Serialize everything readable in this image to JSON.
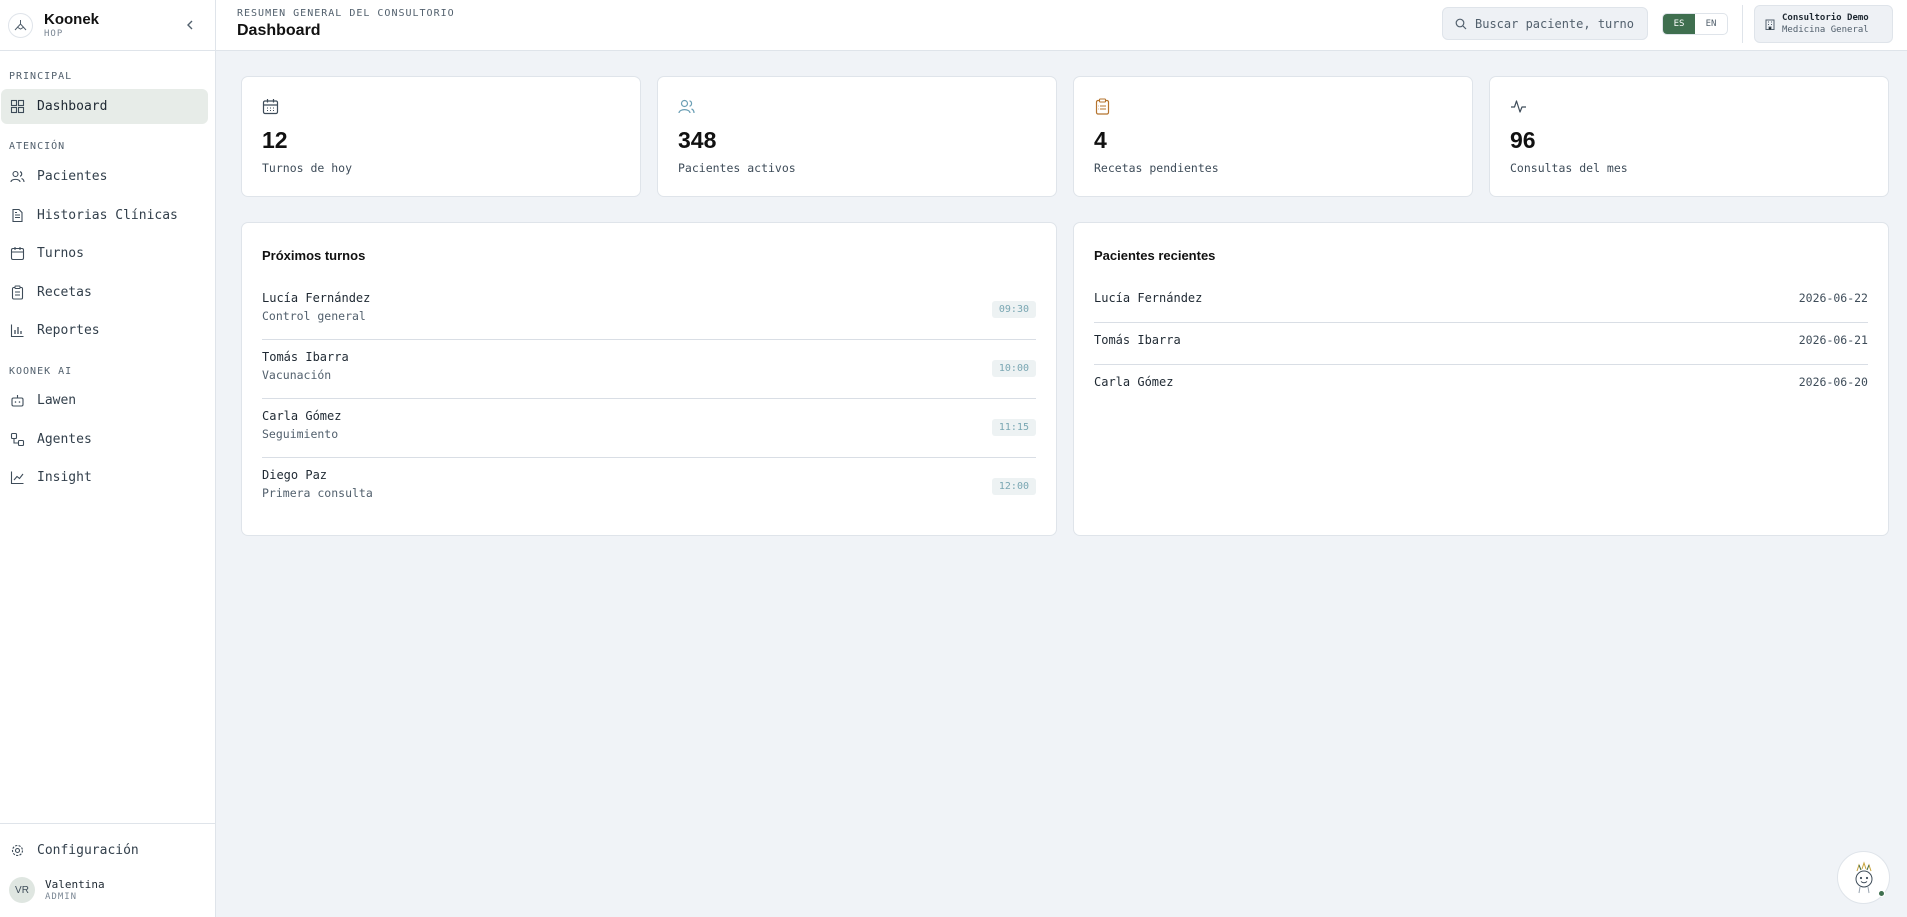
{
  "brand": {
    "name": "Koonek",
    "sub": "HOP"
  },
  "sidebar": {
    "sections": [
      {
        "label": "PRINCIPAL"
      },
      {
        "label": "ATENCIÓN"
      },
      {
        "label": "KOONEK AI"
      }
    ],
    "items": [
      {
        "label": "Dashboard",
        "icon": "grid-icon",
        "active": true
      },
      {
        "label": "Pacientes",
        "icon": "users-icon"
      },
      {
        "label": "Historias Clínicas",
        "icon": "file-text-icon"
      },
      {
        "label": "Turnos",
        "icon": "calendar-icon"
      },
      {
        "label": "Recetas",
        "icon": "clipboard-icon"
      },
      {
        "label": "Reportes",
        "icon": "bar-chart-icon"
      },
      {
        "label": "Lawen",
        "icon": "bot-icon"
      },
      {
        "label": "Agentes",
        "icon": "workflow-icon"
      },
      {
        "label": "Insight",
        "icon": "line-chart-icon"
      }
    ],
    "settings": {
      "label": "Configuración",
      "icon": "gear-icon"
    },
    "user": {
      "initials": "VR",
      "name": "Valentina",
      "role": "ADMIN"
    }
  },
  "header": {
    "kicker": "RESUMEN GENERAL DEL CONSULTORIO",
    "title": "Dashboard",
    "search_placeholder": "Buscar paciente, turno",
    "lang": {
      "es": "ES",
      "en": "EN",
      "selected": "ES"
    },
    "org": {
      "name": "Consultorio Demo",
      "sub": "Medicina General"
    }
  },
  "stats": [
    {
      "value": "12",
      "label": "Turnos de hoy",
      "icon": "calendar-icon",
      "color": "#3e4c59"
    },
    {
      "value": "348",
      "label": "Pacientes activos",
      "icon": "users-icon",
      "color": "#6b9fb5"
    },
    {
      "value": "4",
      "label": "Recetas pendientes",
      "icon": "clipboard-icon",
      "color": "#b5742f"
    },
    {
      "value": "96",
      "label": "Consultas del mes",
      "icon": "activity-icon",
      "color": "#3e4c59"
    }
  ],
  "proximos": {
    "title": "Próximos turnos",
    "rows": [
      {
        "name": "Lucía Fernández",
        "reason": "Control general",
        "time": "09:30"
      },
      {
        "name": "Tomás Ibarra",
        "reason": "Vacunación",
        "time": "10:00"
      },
      {
        "name": "Carla Gómez",
        "reason": "Seguimiento",
        "time": "11:15"
      },
      {
        "name": "Diego Paz",
        "reason": "Primera consulta",
        "time": "12:00"
      }
    ]
  },
  "recientes": {
    "title": "Pacientes recientes",
    "rows": [
      {
        "name": "Lucía Fernández",
        "date": "2026-06-22"
      },
      {
        "name": "Tomás Ibarra",
        "date": "2026-06-21"
      },
      {
        "name": "Carla Gómez",
        "date": "2026-06-20"
      }
    ]
  },
  "colors": {
    "accent": "#3f6f4f",
    "background": "#f0f3f7",
    "time_badge_text": "#7aa7b3"
  }
}
